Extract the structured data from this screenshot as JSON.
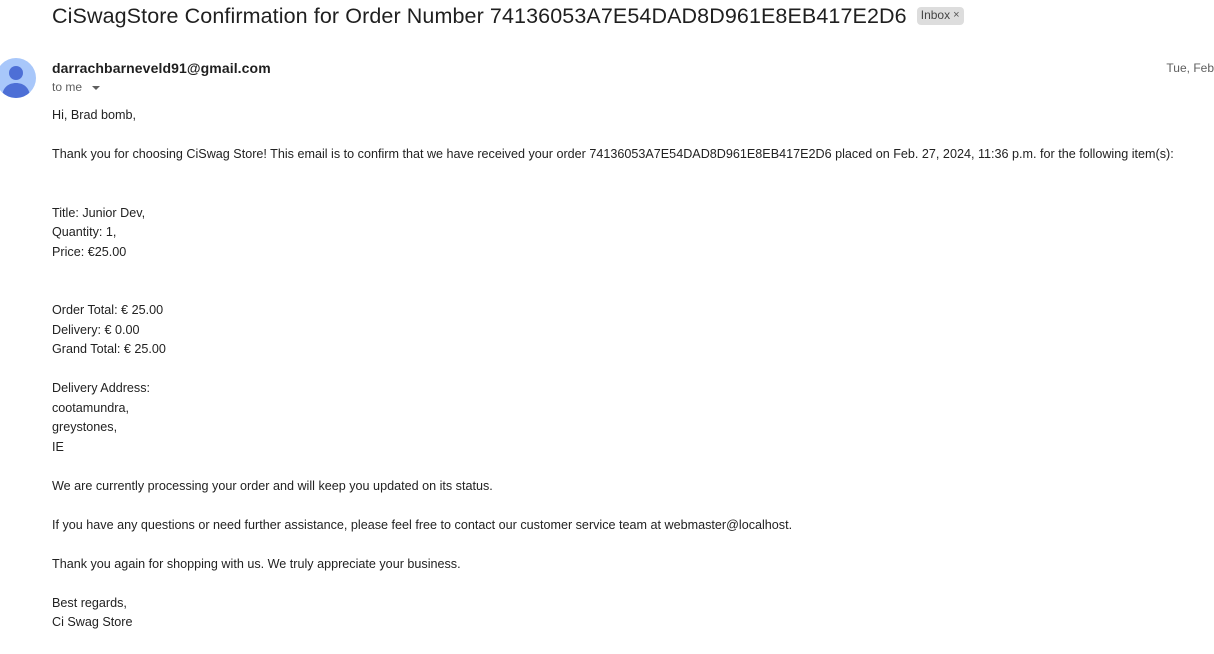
{
  "email": {
    "subject": "CiSwagStore Confirmation for Order Number 74136053A7E54DAD8D961E8EB417E2D6",
    "label": "Inbox",
    "label_close": "×",
    "sender": "darrachbarneveld91@gmail.com",
    "recipient": "to me",
    "date": "Tue, Feb",
    "avatar_color": "#a8c7fa",
    "avatar_icon": "person-icon"
  },
  "body": {
    "greeting": "Hi, Brad bomb,",
    "intro": "Thank you for choosing CiSwag Store! This email is to confirm that we have received your order 74136053A7E54DAD8D961E8EB417E2D6 placed on Feb. 27, 2024, 11:36 p.m. for the following item(s):",
    "item": {
      "title": "Title: Junior Dev,",
      "quantity": "Quantity: 1,",
      "price": "Price:  €25.00"
    },
    "totals": {
      "order_total": "Order Total: € 25.00",
      "delivery": "Delivery: € 0.00",
      "grand_total": "Grand Total: € 25.00"
    },
    "address": {
      "heading": "Delivery Address:",
      "line1": "cootamundra,",
      "line2": "greystones,",
      "line3": "IE"
    },
    "processing": "We are currently processing your order and will keep you updated on its status.",
    "questions": "If you have any questions or need further assistance, please feel free to contact our customer service team at webmaster@localhost.",
    "thanks": "Thank you again for shopping with us. We truly appreciate your business.",
    "signoff": "Best regards,",
    "signature": "Ci Swag Store"
  }
}
